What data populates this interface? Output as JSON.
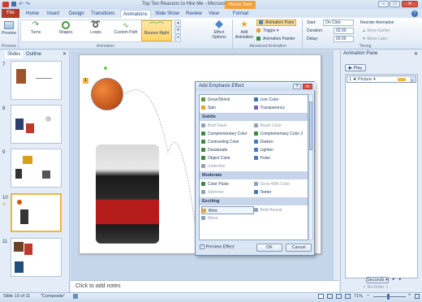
{
  "window": {
    "title": "Top Ten Reasons to Hire Me - Microsoft PowerPoint",
    "context_tab": "Picture Tools"
  },
  "tabs": [
    {
      "label": "File"
    },
    {
      "label": "Home"
    },
    {
      "label": "Insert"
    },
    {
      "label": "Design"
    },
    {
      "label": "Transitions"
    },
    {
      "label": "Animations"
    },
    {
      "label": "Slide Show"
    },
    {
      "label": "Review"
    },
    {
      "label": "View"
    },
    {
      "label": "Format"
    }
  ],
  "ribbon": {
    "preview": {
      "label": "Preview",
      "group": "Preview"
    },
    "animations": {
      "items": [
        {
          "label": "Turns"
        },
        {
          "label": "Shapes"
        },
        {
          "label": "Loops"
        },
        {
          "label": "Custom Path"
        },
        {
          "label": "Bounce Right"
        }
      ],
      "group": "Animation"
    },
    "effect_options": "Effect Options",
    "add_animation": "Add Animation",
    "advanced": {
      "animation_pane": "Animation Pane",
      "trigger": "Trigger",
      "animation_painter": "Animation Painter",
      "group": "Advanced Animation"
    },
    "timing": {
      "start_label": "Start:",
      "start_value": "On Click",
      "duration_label": "Duration:",
      "duration_value": "02.00",
      "delay_label": "Delay:",
      "delay_value": "00.00",
      "reorder_label": "Reorder Animation",
      "move_earlier": "Move Earlier",
      "move_later": "Move Later",
      "group": "Timing"
    }
  },
  "left_pane": {
    "tabs": [
      {
        "label": "Slides"
      },
      {
        "label": "Outline"
      }
    ],
    "slide_numbers": [
      "7",
      "8",
      "9",
      "10",
      "11"
    ]
  },
  "slide": {
    "anim_tag": "1"
  },
  "notes": {
    "placeholder": "Click to add notes"
  },
  "animation_pane": {
    "title": "Animation Pane",
    "play_label": "Play",
    "items": [
      {
        "label": "1 ★ Picture 4"
      }
    ],
    "seconds_label": "Seconds",
    "reorder_label": "Re-Order"
  },
  "dialog": {
    "title": "Add Emphasis Effect",
    "basic": [
      {
        "label": "Grow/Shrink",
        "color": "#5b9a2c",
        "dim": false
      },
      {
        "label": "Line Color",
        "color": "#3a6fb8",
        "dim": false
      },
      {
        "label": "Spin",
        "color": "#e3a52a",
        "dim": false
      },
      {
        "label": "Transparency",
        "color": "#7a5fb0",
        "dim": false
      }
    ],
    "sections": [
      {
        "name": "Subtle",
        "items": [
          {
            "label": "Bold Flash",
            "color": "#8da2bd",
            "dim": true
          },
          {
            "label": "Brush Color",
            "color": "#8da2bd",
            "dim": true
          },
          {
            "label": "Complementary Color",
            "color": "#3a8a3e",
            "dim": false
          },
          {
            "label": "Complementary Color 2",
            "color": "#3a8a3e",
            "dim": false
          },
          {
            "label": "Contrasting Color",
            "color": "#3a8a3e",
            "dim": false
          },
          {
            "label": "Darken",
            "color": "#4a77bb",
            "dim": false
          },
          {
            "label": "Desaturate",
            "color": "#3a8a3e",
            "dim": false
          },
          {
            "label": "Lighten",
            "color": "#4a77bb",
            "dim": false
          },
          {
            "label": "Object Color",
            "color": "#3a8a3e",
            "dim": false
          },
          {
            "label": "Pulse",
            "color": "#4a77bb",
            "dim": false
          },
          {
            "label": "Underline",
            "color": "#8da2bd",
            "dim": true
          }
        ]
      },
      {
        "name": "Moderate",
        "items": [
          {
            "label": "Color Pulse",
            "color": "#3a8a3e",
            "dim": false
          },
          {
            "label": "Grow With Color",
            "color": "#8da2bd",
            "dim": true
          },
          {
            "label": "Shimmer",
            "color": "#8da2bd",
            "dim": true
          },
          {
            "label": "Teeter",
            "color": "#4a77bb",
            "dim": false
          }
        ]
      },
      {
        "name": "Exciting",
        "items": [
          {
            "label": "Blink",
            "color": "#e3a52a",
            "dim": false
          },
          {
            "label": "Bold Reveal",
            "color": "#8da2bd",
            "dim": true
          },
          {
            "label": "Wave",
            "color": "#8da2bd",
            "dim": true
          }
        ]
      }
    ],
    "preview_label": "Preview Effect",
    "ok": "OK",
    "cancel": "Cancel"
  },
  "status": {
    "slide_info": "Slide 10 of 11",
    "theme": "\"Composite\"",
    "zoom": "71%"
  }
}
